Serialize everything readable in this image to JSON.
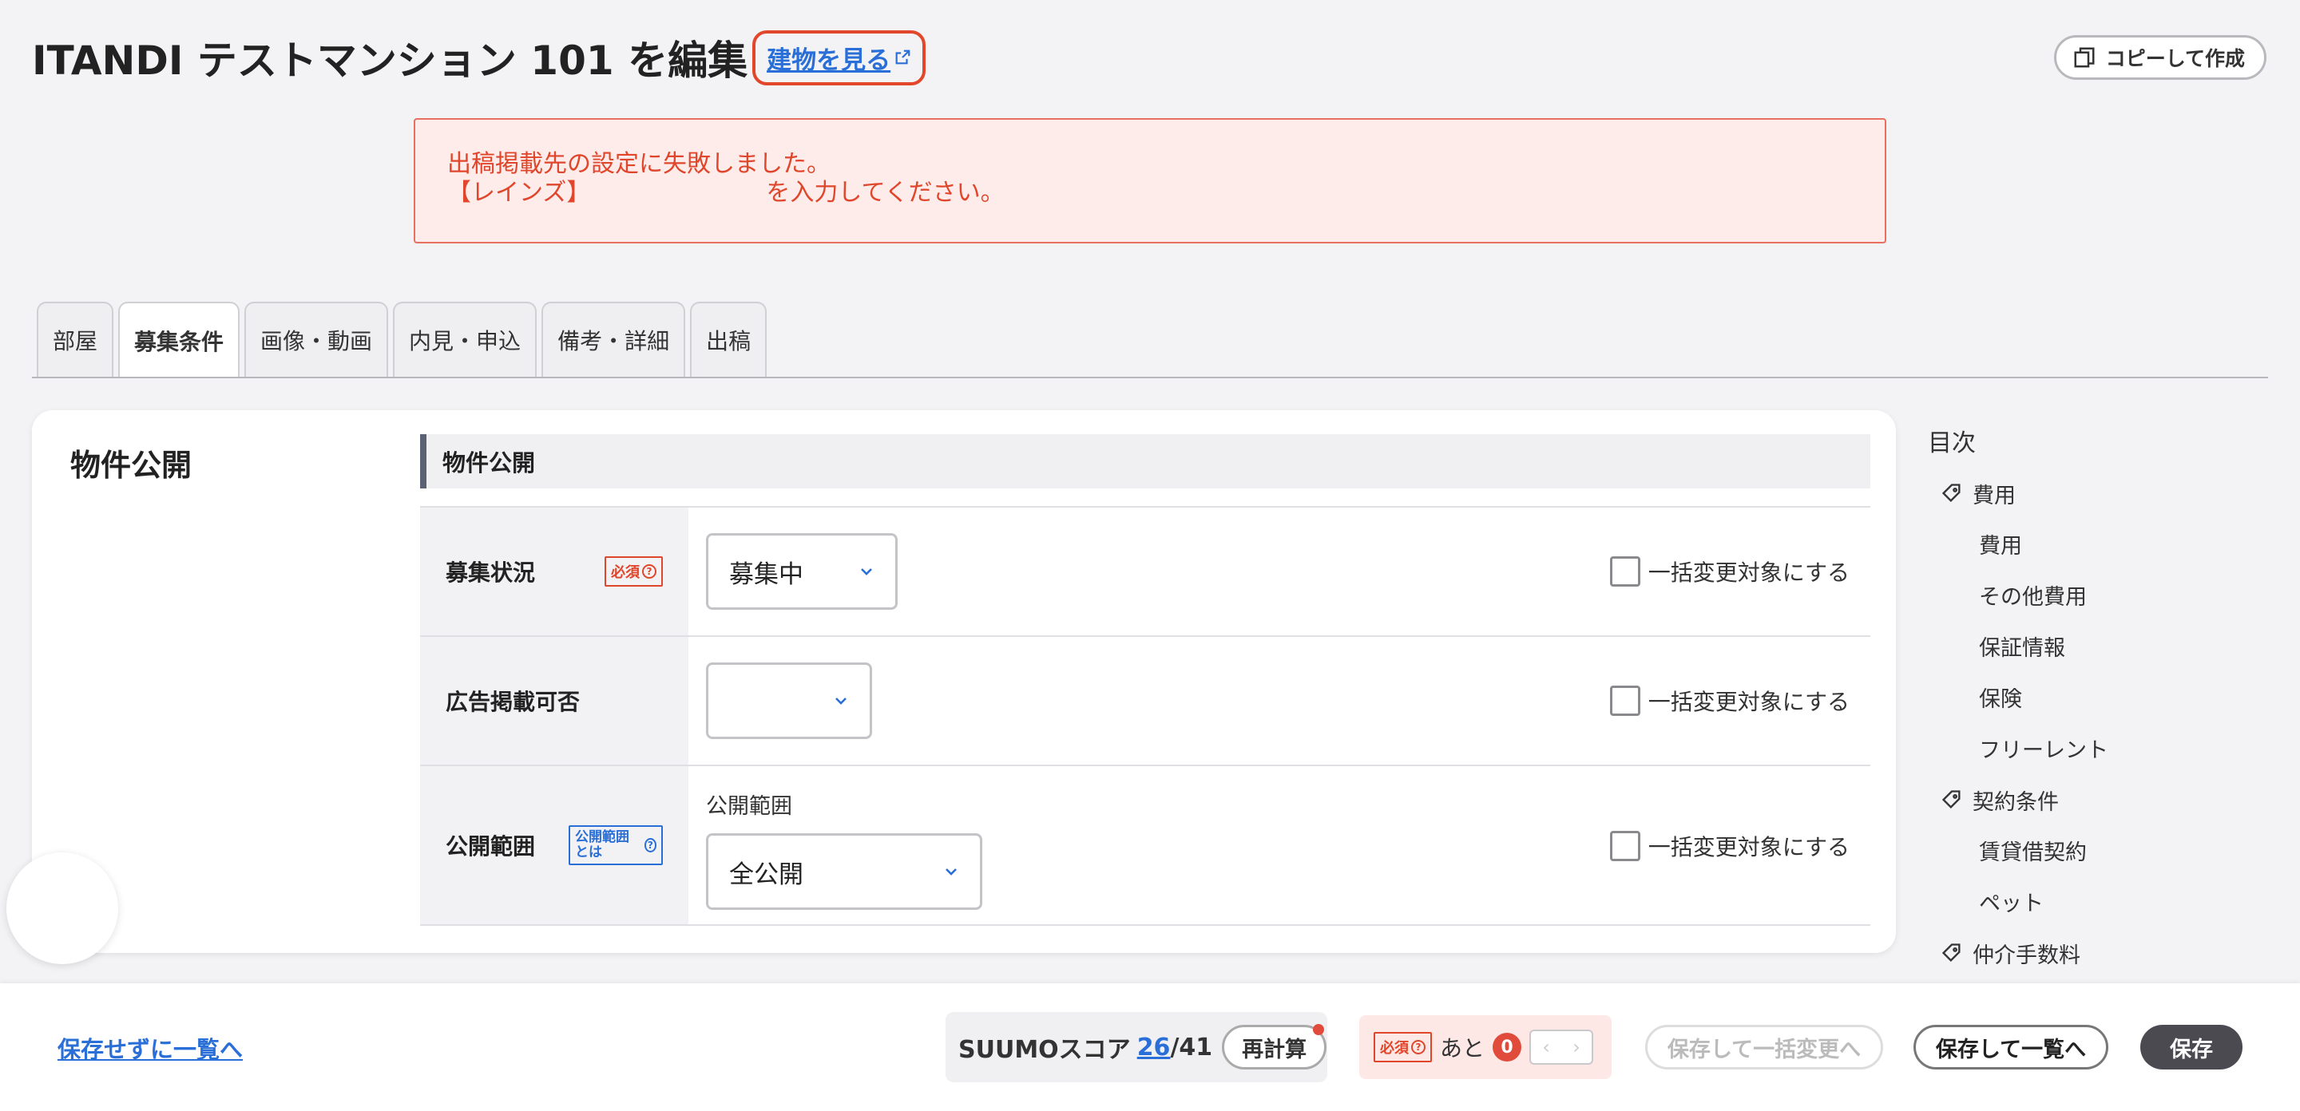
{
  "header": {
    "title": "ITANDI テストマンション 101 を編集",
    "view_building_label": "建物を見る",
    "copy_button_label": "コピーして作成"
  },
  "error": {
    "line1": "出稿掲載先の設定に失敗しました。",
    "line2_prefix": "【レインズ】",
    "line2_suffix": "を入力してください。"
  },
  "tabs": [
    {
      "label": "部屋"
    },
    {
      "label": "募集条件"
    },
    {
      "label": "画像・動画"
    },
    {
      "label": "内見・申込"
    },
    {
      "label": "備考・詳細"
    },
    {
      "label": "出稿"
    }
  ],
  "section": {
    "card_title": "物件公開",
    "head": "物件公開",
    "required_badge": "必須",
    "info_badge": "公開範囲とは",
    "bulk_label": "一括変更対象にする",
    "rows": [
      {
        "label": "募集状況",
        "value": "募集中"
      },
      {
        "label": "広告掲載可否",
        "value": ""
      },
      {
        "label": "公開範囲",
        "caption": "公開範囲",
        "value": "全公開"
      }
    ]
  },
  "toc": {
    "title": "目次",
    "groups": [
      {
        "label": "費用",
        "items": [
          "費用",
          "その他費用",
          "保証情報",
          "保険",
          "フリーレント"
        ]
      },
      {
        "label": "契約条件",
        "items": [
          "賃貸借契約",
          "ペット"
        ]
      },
      {
        "label": "仲介手数料",
        "items": []
      }
    ]
  },
  "footer": {
    "back_link": "保存せずに一覧へ",
    "suumo_label": "SUUMOスコア",
    "suumo_score": "26",
    "suumo_total": "/41",
    "recalc_label": "再計算",
    "required_badge": "必須",
    "remain_label": "あと",
    "remain_count": "0",
    "bulk_save_label": "保存して一括変更へ",
    "save_list_label": "保存して一覧へ",
    "save_label": "保存"
  }
}
